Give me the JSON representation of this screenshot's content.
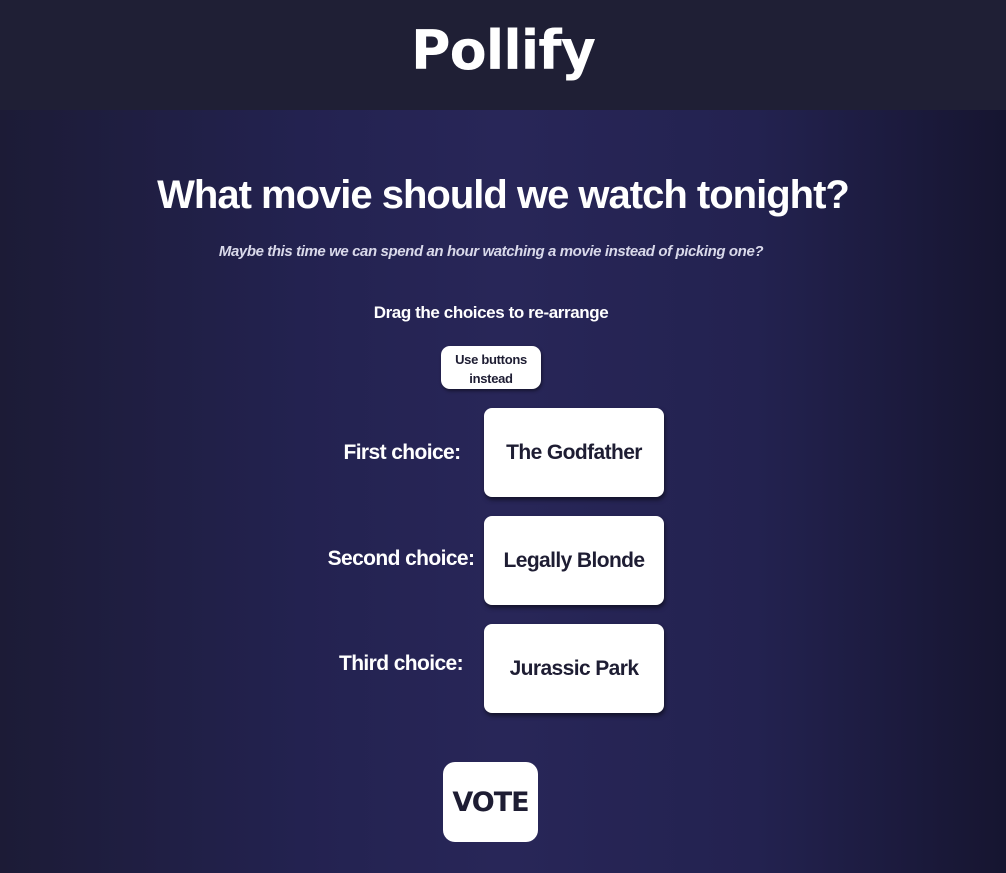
{
  "header": {
    "logo_text": "Pollify"
  },
  "poll": {
    "title": "What movie should we watch tonight?",
    "subtitle": "Maybe this time we can spend an hour watching a movie instead of picking one?",
    "instructions": "Drag the choices to re-arrange",
    "mode_button_label": "Use buttons instead",
    "rows": [
      {
        "label": "First choice:",
        "choice": "The Godfather"
      },
      {
        "label": "Second choice:",
        "choice": "Legally Blonde"
      },
      {
        "label": "Third choice:",
        "choice": "Jurassic Park"
      }
    ],
    "vote_button_label": "VOTE"
  },
  "colors": {
    "header_bg": "#1f1f35",
    "page_bg": "#282658",
    "card_bg": "#ffffff",
    "card_text": "#1e1d33"
  }
}
